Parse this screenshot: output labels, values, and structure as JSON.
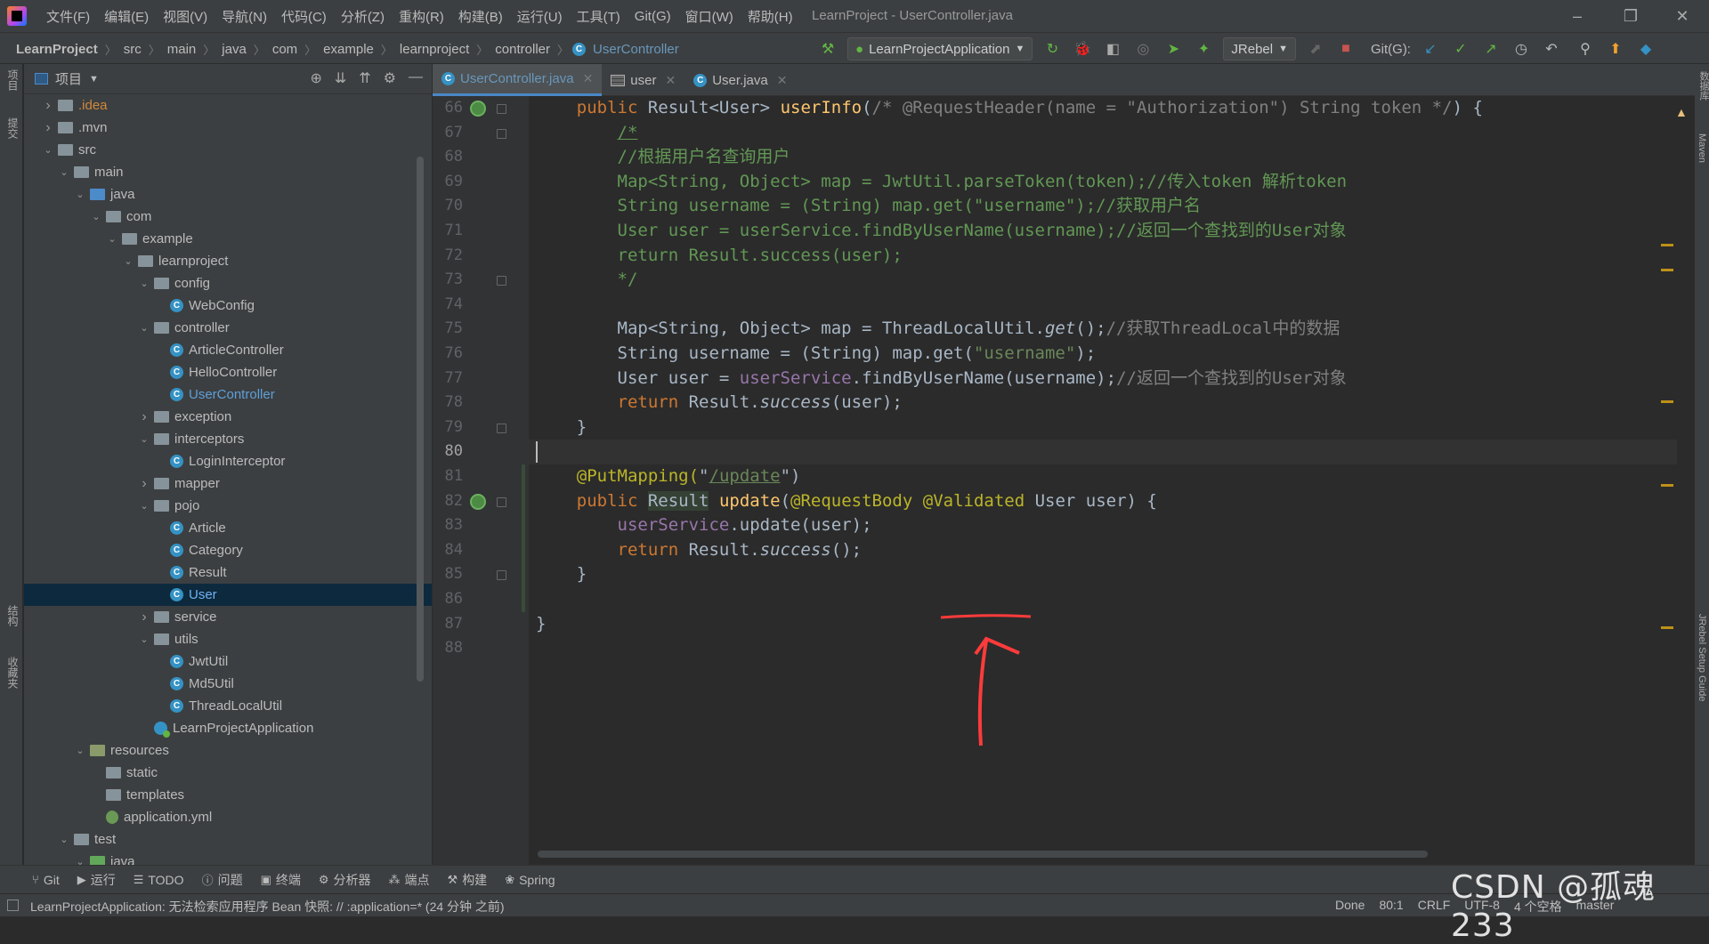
{
  "menu": [
    "文件(F)",
    "编辑(E)",
    "视图(V)",
    "导航(N)",
    "代码(C)",
    "分析(Z)",
    "重构(R)",
    "构建(B)",
    "运行(U)",
    "工具(T)",
    "Git(G)",
    "窗口(W)",
    "帮助(H)"
  ],
  "window_title": "LearnProject - UserController.java",
  "breadcrumb": [
    "LearnProject",
    "src",
    "main",
    "java",
    "com",
    "example",
    "learnproject",
    "controller",
    "UserController"
  ],
  "run_config": "LearnProjectApplication",
  "jrebel": "JRebel",
  "git_label": "Git(G):",
  "project_panel": {
    "title": "项目"
  },
  "tree": [
    {
      "label": ".idea",
      "indent": 1,
      "arrow": ">",
      "type": "folder",
      "color": "orange"
    },
    {
      "label": ".mvn",
      "indent": 1,
      "arrow": ">",
      "type": "folder"
    },
    {
      "label": "src",
      "indent": 1,
      "arrow": "v",
      "type": "folder"
    },
    {
      "label": "main",
      "indent": 2,
      "arrow": "v",
      "type": "folder"
    },
    {
      "label": "java",
      "indent": 3,
      "arrow": "v",
      "type": "folder-blue"
    },
    {
      "label": "com",
      "indent": 4,
      "arrow": "v",
      "type": "folder"
    },
    {
      "label": "example",
      "indent": 5,
      "arrow": "v",
      "type": "folder"
    },
    {
      "label": "learnproject",
      "indent": 6,
      "arrow": "v",
      "type": "folder"
    },
    {
      "label": "config",
      "indent": 7,
      "arrow": "v",
      "type": "folder"
    },
    {
      "label": "WebConfig",
      "indent": 8,
      "arrow": "",
      "type": "class"
    },
    {
      "label": "controller",
      "indent": 7,
      "arrow": "v",
      "type": "folder"
    },
    {
      "label": "ArticleController",
      "indent": 8,
      "arrow": "",
      "type": "class"
    },
    {
      "label": "HelloController",
      "indent": 8,
      "arrow": "",
      "type": "class"
    },
    {
      "label": "UserController",
      "indent": 8,
      "arrow": "",
      "type": "class",
      "color": "blue"
    },
    {
      "label": "exception",
      "indent": 7,
      "arrow": ">",
      "type": "folder"
    },
    {
      "label": "interceptors",
      "indent": 7,
      "arrow": "v",
      "type": "folder"
    },
    {
      "label": "LoginInterceptor",
      "indent": 8,
      "arrow": "",
      "type": "class"
    },
    {
      "label": "mapper",
      "indent": 7,
      "arrow": ">",
      "type": "folder"
    },
    {
      "label": "pojo",
      "indent": 7,
      "arrow": "v",
      "type": "folder"
    },
    {
      "label": "Article",
      "indent": 8,
      "arrow": "",
      "type": "class"
    },
    {
      "label": "Category",
      "indent": 8,
      "arrow": "",
      "type": "class"
    },
    {
      "label": "Result",
      "indent": 8,
      "arrow": "",
      "type": "class"
    },
    {
      "label": "User",
      "indent": 8,
      "arrow": "",
      "type": "class",
      "selected": true
    },
    {
      "label": "service",
      "indent": 7,
      "arrow": ">",
      "type": "folder"
    },
    {
      "label": "utils",
      "indent": 7,
      "arrow": "v",
      "type": "folder"
    },
    {
      "label": "JwtUtil",
      "indent": 8,
      "arrow": "",
      "type": "class"
    },
    {
      "label": "Md5Util",
      "indent": 8,
      "arrow": "",
      "type": "class"
    },
    {
      "label": "ThreadLocalUtil",
      "indent": 8,
      "arrow": "",
      "type": "class"
    },
    {
      "label": "LearnProjectApplication",
      "indent": 7,
      "arrow": "",
      "type": "app"
    },
    {
      "label": "resources",
      "indent": 3,
      "arrow": "v",
      "type": "folder-res"
    },
    {
      "label": "static",
      "indent": 4,
      "arrow": "",
      "type": "folder"
    },
    {
      "label": "templates",
      "indent": 4,
      "arrow": "",
      "type": "folder"
    },
    {
      "label": "application.yml",
      "indent": 4,
      "arrow": "",
      "type": "yml"
    },
    {
      "label": "test",
      "indent": 2,
      "arrow": "v",
      "type": "folder"
    },
    {
      "label": "java",
      "indent": 3,
      "arrow": "v",
      "type": "folder-green"
    }
  ],
  "tabs": [
    {
      "label": "UserController.java",
      "icon": "class-icon",
      "active": true
    },
    {
      "label": "user",
      "icon": "table-icon",
      "active": false
    },
    {
      "label": "User.java",
      "icon": "class-icon",
      "active": false
    }
  ],
  "inspections": {
    "warnings": "4",
    "weak_warnings": "2"
  },
  "line_numbers": [
    "66",
    "67",
    "68",
    "69",
    "70",
    "71",
    "72",
    "73",
    "74",
    "75",
    "76",
    "77",
    "78",
    "79",
    "80",
    "81",
    "82",
    "83",
    "84",
    "85",
    "86",
    "87",
    "88"
  ],
  "code": {
    "l66": [
      "public ",
      "Result<User> ",
      "userInfo",
      "(",
      "/* @RequestHeader(name = \"Authorization\") String token */",
      ") {"
    ],
    "l67": "/*",
    "l68": "//根据用户名查询用户",
    "l69": "Map<String, Object> map = JwtUtil.parseToken(token);//传入token 解析token",
    "l70": "String username = (String) map.get(\"username\");//获取用户名",
    "l71": "User user = userService.findByUserName(username);//返回一个查找到的User对象",
    "l72": "return Result.success(user);",
    "l73": "*/",
    "l75": [
      "Map<String, Object> map = ThreadLocalUtil.",
      "get",
      "();",
      "//获取ThreadLocal中的数据"
    ],
    "l76": [
      "String username = (String) map.get(",
      "\"username\"",
      ");"
    ],
    "l77": [
      "User user = ",
      "userService",
      ".findByUserName(username);",
      "//返回一个查找到的User对象"
    ],
    "l78": [
      "return ",
      "Result.",
      "success",
      "(user);"
    ],
    "l79": "}",
    "l81": [
      "@PutMapping(",
      "\"",
      "/update",
      "\")"
    ],
    "l82": [
      "public ",
      "Result",
      " ",
      "update",
      "(",
      "@RequestBody ",
      "@Validated",
      " User user) {"
    ],
    "l83": [
      "userService",
      ".update(user);"
    ],
    "l84": [
      "return ",
      "Result.",
      "success",
      "();"
    ],
    "l85": "}",
    "l87": "}"
  },
  "toolwindows": [
    "Git",
    "运行",
    "TODO",
    "问题",
    "终端",
    "分析器",
    "端点",
    "构建",
    "Spring"
  ],
  "status": {
    "message": "LearnProjectApplication: 无法检索应用程序 Bean 快照: // :application=* (24 分钟 之前)",
    "done": "Done",
    "position": "80:1",
    "line_sep": "CRLF",
    "encoding": "UTF-8",
    "indent": "4 个空格",
    "branch": "master"
  },
  "left_strip": [
    "项目",
    "提交",
    "结构",
    "收藏夹"
  ],
  "right_strip": [
    "数据库",
    "Maven",
    "JRebel Setup Guide"
  ],
  "watermark": "CSDN @孤魂233"
}
